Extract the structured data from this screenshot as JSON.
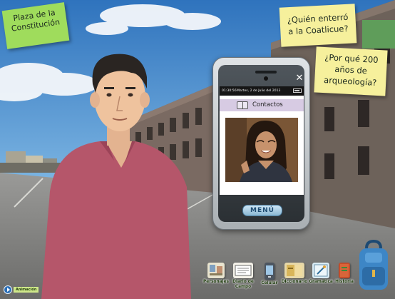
{
  "location_note": {
    "line1": "Plaza de la",
    "line2": "Constitución"
  },
  "questions": [
    {
      "lines": [
        "¿Quién enterró",
        "a la Coatlicue?"
      ]
    },
    {
      "lines": [
        "¿Por qué 200",
        "años de",
        "arqueología?"
      ]
    }
  ],
  "phone": {
    "status_time": "01:30:56",
    "status_date": "Martes, 2 de Julio del 2013",
    "screen_title": "Contactos",
    "menu_label": "MENÚ",
    "close_label": "✕"
  },
  "toolbar": {
    "items": [
      {
        "label": "Personajes",
        "icon": "characters-icon"
      },
      {
        "label": "Diario de Campo",
        "label_lines": [
          "Diario de",
          "Campo"
        ],
        "icon": "field-journal-icon"
      },
      {
        "label": "Celular",
        "icon": "cellphone-icon"
      },
      {
        "label": "Diccionario",
        "icon": "dictionary-icon"
      },
      {
        "label": "Gramática",
        "icon": "grammar-icon"
      },
      {
        "label": "Historia",
        "icon": "history-icon"
      }
    ]
  },
  "animation_button": {
    "label": "Animación"
  },
  "colors": {
    "sky": "#3f83c9",
    "note_green": "#9fdc5c",
    "note_yellow": "#f6f09c",
    "shirt": "#b5566a",
    "menu_text": "#1f4c72"
  }
}
